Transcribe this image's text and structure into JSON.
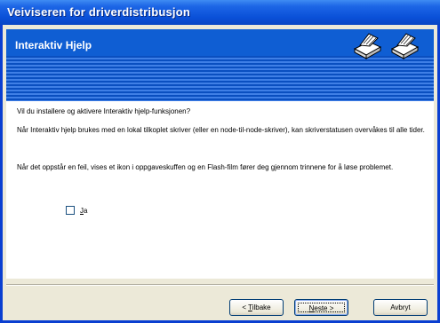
{
  "window": {
    "title": "Veiviseren for driverdistribusjon"
  },
  "banner": {
    "title": "Interaktiv Hjelp",
    "icons": [
      "printer-icon",
      "printer-icon"
    ]
  },
  "content": {
    "question": "Vil du installere og aktivere Interaktiv hjelp-funksjonen?",
    "para1": "Når Interaktiv hjelp brukes med en lokal tilkoplet skriver (eller en node-til-node-skriver), kan skriverstatusen overvåkes til alle tider.",
    "para2": "Når det oppstår en feil, vises et ikon i oppgaveskuffen og en Flash-film fører deg gjennom trinnene for å løse problemet.",
    "checkbox": {
      "label_underlined": "J",
      "label_rest": "a",
      "checked": false
    }
  },
  "buttons": {
    "back": {
      "prefix": "< ",
      "underlined": "T",
      "rest": "ilbake"
    },
    "next": {
      "underlined": "N",
      "rest": "este >"
    },
    "cancel": {
      "label": "Avbryt"
    }
  },
  "colors": {
    "titlebar": "#0a50d8",
    "banner": "#0b57c9",
    "dialog_bg": "#ece9d8"
  }
}
